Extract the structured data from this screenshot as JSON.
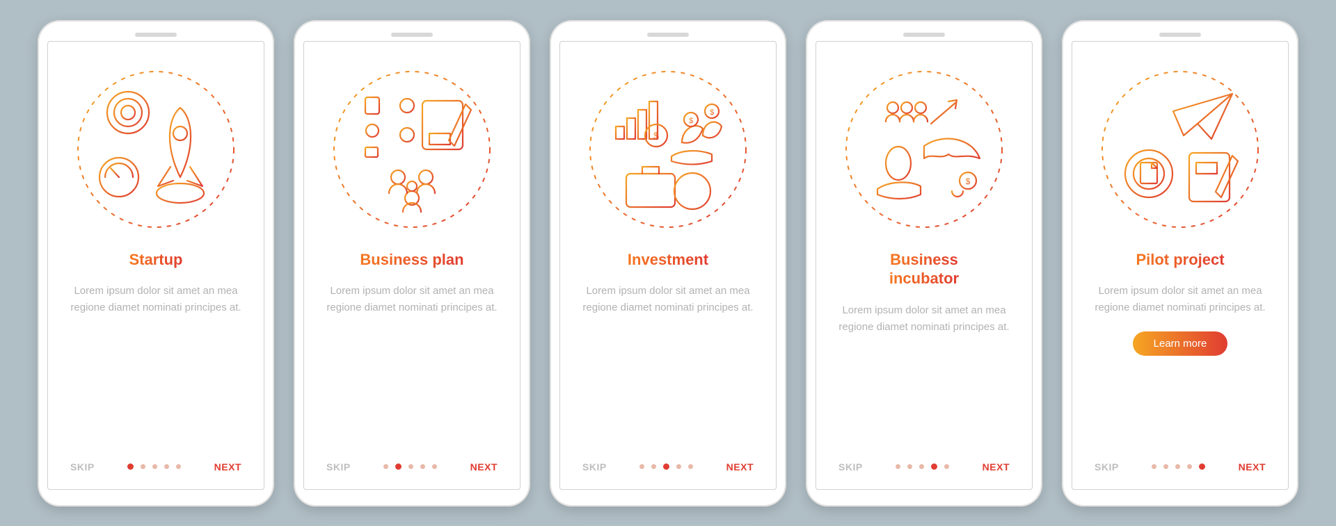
{
  "common": {
    "skip": "SKIP",
    "next": "NEXT",
    "desc": "Lorem ipsum dolor sit amet an mea regione diamet nominati principes at.",
    "cta": "Learn more"
  },
  "screens": [
    {
      "title": "Startup",
      "activeDot": 0,
      "icon": "startup",
      "showCta": false
    },
    {
      "title": "Business plan",
      "activeDot": 1,
      "icon": "business-plan",
      "showCta": false
    },
    {
      "title": "Investment",
      "activeDot": 2,
      "icon": "investment",
      "showCta": false
    },
    {
      "title": "Business\nincubator",
      "activeDot": 3,
      "icon": "business-incubator",
      "showCta": false
    },
    {
      "title": "Pilot project",
      "activeDot": 4,
      "icon": "pilot-project",
      "showCta": true
    }
  ],
  "dotCount": 5
}
